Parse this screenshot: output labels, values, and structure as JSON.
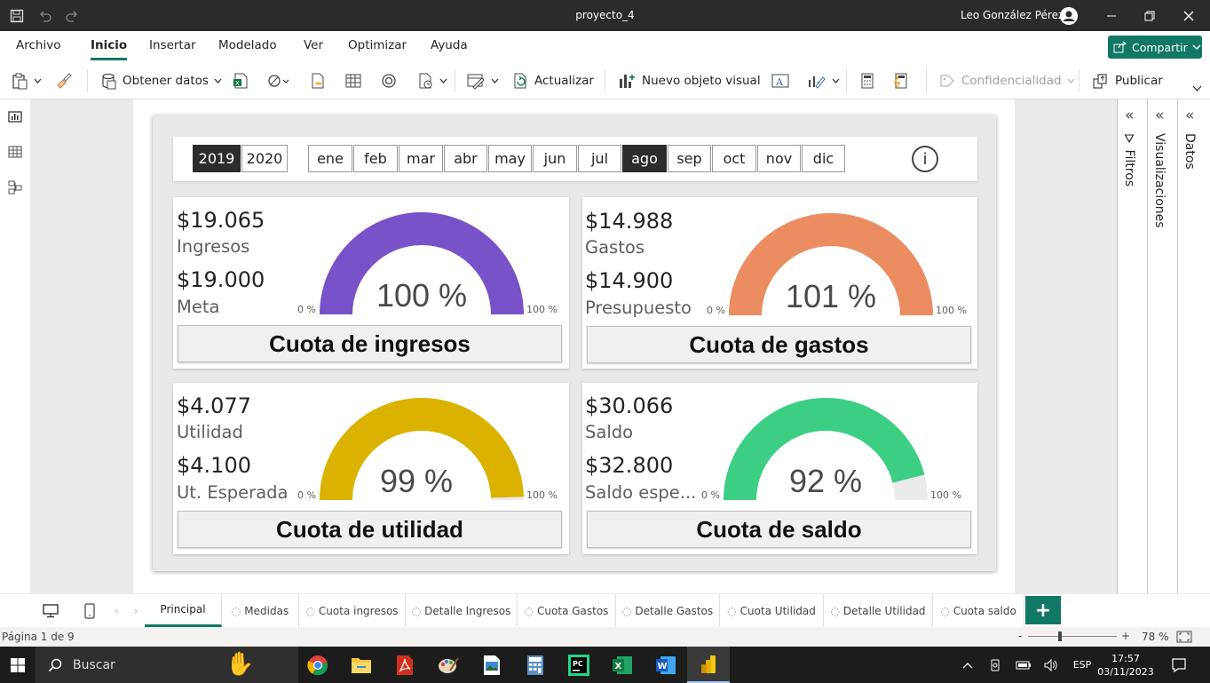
{
  "window": {
    "title": "proyecto_4",
    "user": "Leo González Pérez"
  },
  "menu": {
    "items": [
      "Archivo",
      "Inicio",
      "Insertar",
      "Modelado",
      "Ver",
      "Optimizar",
      "Ayuda"
    ],
    "active": "Inicio",
    "share_label": "Compartir"
  },
  "ribbon": {
    "get_data": "Obtener datos",
    "refresh": "Actualizar",
    "new_visual": "Nuevo objeto visual",
    "sensitivity": "Confidencialidad",
    "publish": "Publicar"
  },
  "slicers": {
    "years": [
      "2019",
      "2020"
    ],
    "selected_year": "2019",
    "months": [
      "ene",
      "feb",
      "mar",
      "abr",
      "may",
      "jun",
      "jul",
      "ago",
      "sep",
      "oct",
      "nov",
      "dic"
    ],
    "selected_month": "ago",
    "info_glyph": "i"
  },
  "cards": [
    {
      "value": "$19.065",
      "value_label": "Ingresos",
      "target": "$19.000",
      "target_label": "Meta",
      "percent": "100 %",
      "gauge_fraction": 1.0,
      "gauge_min": "0 %",
      "gauge_max": "100 %",
      "color": "#7951c8",
      "title": "Cuota de ingresos"
    },
    {
      "value": "$14.988",
      "value_label": "Gastos",
      "target": "$14.900",
      "target_label": "Presupuesto",
      "percent": "101 %",
      "gauge_fraction": 1.0,
      "gauge_min": "0 %",
      "gauge_max": "100 %",
      "color": "#ec8c61",
      "title": "Cuota de gastos"
    },
    {
      "value": "$4.077",
      "value_label": "Utilidad",
      "target": "$4.100",
      "target_label": "Ut. Esperada",
      "percent": "99 %",
      "gauge_fraction": 0.99,
      "gauge_min": "0 %",
      "gauge_max": "100 %",
      "color": "#dbb200",
      "title": "Cuota de utilidad"
    },
    {
      "value": "$30.066",
      "value_label": "Saldo",
      "target": "$32.800",
      "target_label": "Saldo espe...",
      "percent": "92 %",
      "gauge_fraction": 0.92,
      "gauge_min": "0 %",
      "gauge_max": "100 %",
      "color": "#3ccf84",
      "title": "Cuota de saldo"
    }
  ],
  "panes": {
    "filters": "Filtros",
    "visualizations": "Visualizaciones",
    "data": "Datos"
  },
  "pages": {
    "tabs": [
      "Principal",
      "Medidas",
      "Cuota ingresos",
      "Detalle Ingresos",
      "Cuota Gastos",
      "Detalle Gastos",
      "Cuota Utilidad",
      "Detalle Utilidad",
      "Cuota saldo"
    ],
    "active": "Principal",
    "add_label": "+"
  },
  "status": {
    "page_info": "Página 1 de 9",
    "zoom": "78 %",
    "zoom_minus": "-",
    "zoom_plus": "+"
  },
  "taskbar": {
    "search": "Buscar",
    "language": "ESP",
    "time": "17:57",
    "date": "03/11/2023"
  }
}
